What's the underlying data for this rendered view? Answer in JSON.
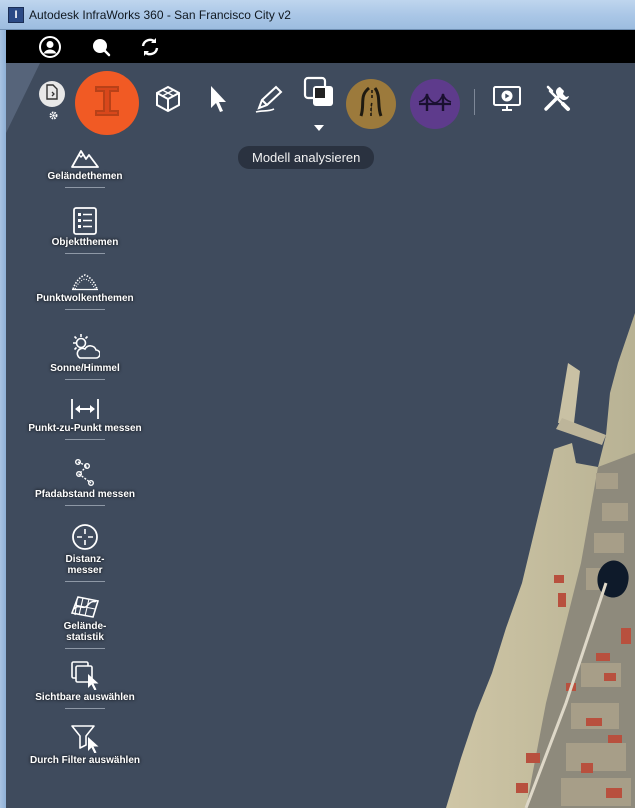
{
  "window": {
    "title": "Autodesk InfraWorks 360 - San Francisco City v2",
    "app_icon_letter": "I"
  },
  "topbar": {
    "icons": [
      "user-icon",
      "search-icon",
      "sync-icon"
    ]
  },
  "ribbon": {
    "items": [
      {
        "name": "model-settings-button",
        "icon": "document-gear-icon"
      },
      {
        "name": "infraworks-home-button",
        "icon": "infraworks-logo-icon",
        "color": "#f15a24"
      },
      {
        "name": "create-model-button",
        "icon": "cube-icon"
      },
      {
        "name": "select-button",
        "icon": "cursor-arrow-icon"
      },
      {
        "name": "sketch-button",
        "icon": "pencil-icon"
      },
      {
        "name": "analyze-model-button",
        "icon": "overlap-squares-icon"
      },
      {
        "name": "roads-button",
        "icon": "road-icon",
        "color": "#9c7a3c"
      },
      {
        "name": "bridges-button",
        "icon": "bridge-icon",
        "color": "#5e3b8c"
      },
      {
        "name": "presentation-button",
        "icon": "monitor-play-icon"
      },
      {
        "name": "tools-button",
        "icon": "wrench-screwdriver-icon"
      }
    ],
    "tooltip": "Modell analysieren"
  },
  "analysis_panel": {
    "tools": [
      {
        "label": "Geländethemen",
        "icon": "mountain-icon"
      },
      {
        "label": "Objektthemen",
        "icon": "list-icon"
      },
      {
        "label": "Punktwolkenthemen",
        "icon": "point-cloud-icon"
      },
      {
        "label": "Sonne/Himmel",
        "icon": "sun-cloud-icon"
      },
      {
        "label": "Punkt-zu-Punkt messen",
        "icon": "measure-arrows-icon"
      },
      {
        "label": "Pfadabstand messen",
        "icon": "path-distance-icon"
      },
      {
        "label": "Distanz-\nmesser",
        "icon": "crosshair-icon"
      },
      {
        "label": "Gelände-\nstatistik",
        "icon": "terrain-grid-icon"
      },
      {
        "label": "Sichtbare auswählen",
        "icon": "select-visible-icon"
      },
      {
        "label": "Durch Filter auswählen",
        "icon": "filter-select-icon"
      }
    ]
  }
}
